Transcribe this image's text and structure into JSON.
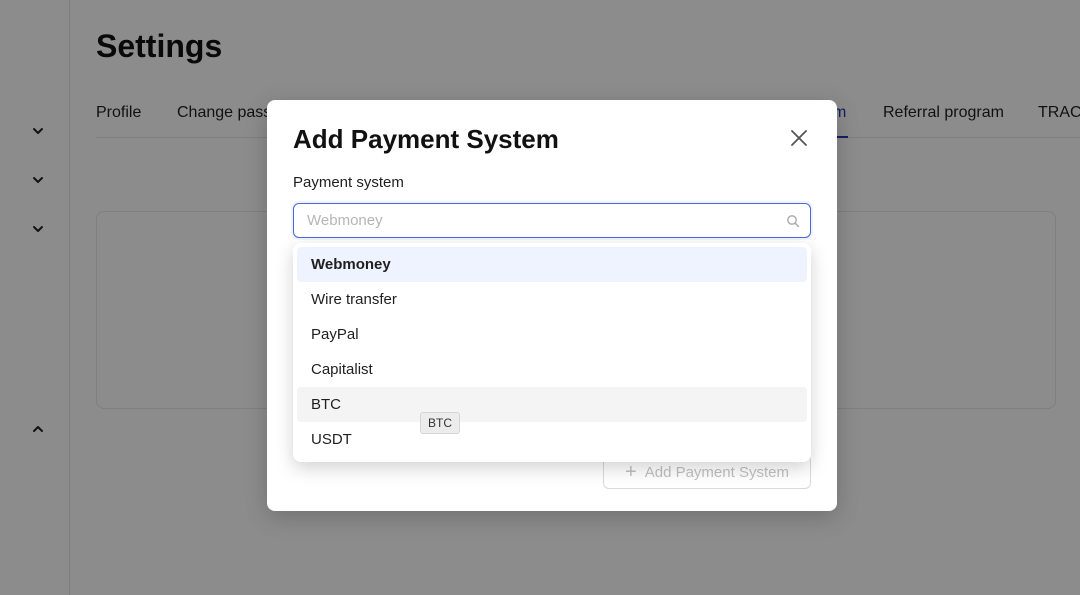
{
  "page": {
    "title": "Settings"
  },
  "tabs": [
    {
      "label": "Profile"
    },
    {
      "label": "Change pass"
    },
    {
      "label": "m"
    },
    {
      "label": "Referral program"
    },
    {
      "label": "TRAC"
    }
  ],
  "sidebar": {
    "icons": [
      "chevron-down-icon",
      "chevron-down-icon",
      "chevron-down-icon",
      "chevron-up-icon"
    ]
  },
  "modal": {
    "title": "Add Payment System",
    "field_label": "Payment system",
    "select_placeholder": "Webmoney",
    "add_button_label": "Add Payment System"
  },
  "dropdown": {
    "options": [
      "Webmoney",
      "Wire transfer",
      "PayPal",
      "Capitalist",
      "BTC",
      "USDT"
    ],
    "selected": "Webmoney",
    "hovered": "BTC"
  },
  "tooltip": {
    "text": "BTC"
  },
  "colors": {
    "accent": "#1f3bb3",
    "focus_border": "#4a68d8",
    "selected_bg": "#eef3ff",
    "hover_bg": "#f4f4f4"
  }
}
